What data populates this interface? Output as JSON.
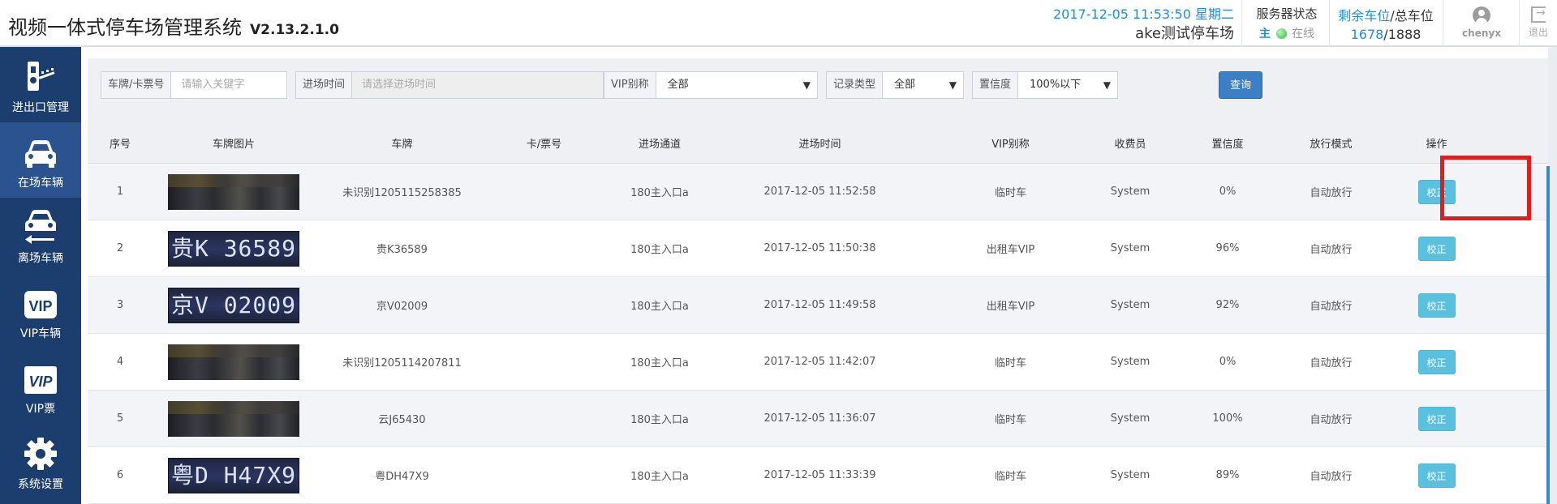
{
  "header": {
    "title": "视频一体式停车场管理系统",
    "version": "V2.13.2.1.0",
    "datetime": "2017-12-05 11:53:50 星期二",
    "lot_name": "ake测试停车场",
    "server_label": "服务器状态",
    "server_role": "主",
    "server_status": "在线",
    "spaces_label_remaining": "剩余车位",
    "spaces_label_sep": "/",
    "spaces_label_total": "总车位",
    "spaces_remaining": "1678",
    "spaces_total": "1888",
    "user": "chenyx",
    "logout": "退出"
  },
  "sidebar": {
    "items": [
      {
        "label": "进出口管理",
        "icon": "gate-barrier-icon"
      },
      {
        "label": "在场车辆",
        "icon": "car-icon"
      },
      {
        "label": "离场车辆",
        "icon": "car-leaving-icon"
      },
      {
        "label": "VIP车辆",
        "icon": "vip-icon"
      },
      {
        "label": "VIP票",
        "icon": "vip-ticket-icon"
      },
      {
        "label": "系统设置",
        "icon": "gear-icon"
      }
    ]
  },
  "filters": {
    "plate_label": "车牌/卡票号",
    "plate_placeholder": "请输入关键字",
    "time_label": "进场时间",
    "time_placeholder": "请选择进场时间",
    "vip_label": "VIP别称",
    "vip_value": "全部",
    "record_label": "记录类型",
    "record_value": "全部",
    "confidence_label": "置信度",
    "confidence_value": "100%以下",
    "query_button": "查询"
  },
  "table": {
    "columns": [
      "序号",
      "车牌图片",
      "车牌",
      "卡/票号",
      "进场通道",
      "进场时间",
      "VIP别称",
      "收费员",
      "置信度",
      "放行模式",
      "操作"
    ],
    "rows": [
      {
        "no": "1",
        "image": "scene",
        "plate_text": "",
        "plate": "未识别1205115258385",
        "card": "",
        "channel": "180主入口a",
        "time": "2017-12-05 11:52:58",
        "vip": "临时车",
        "operator": "System",
        "confidence": "0%",
        "mode": "自动放行",
        "action": "校正"
      },
      {
        "no": "2",
        "image": "plate",
        "plate_text": "贵K 36589",
        "plate": "贵K36589",
        "card": "",
        "channel": "180主入口a",
        "time": "2017-12-05 11:50:38",
        "vip": "出租车VIP",
        "operator": "System",
        "confidence": "96%",
        "mode": "自动放行",
        "action": "校正"
      },
      {
        "no": "3",
        "image": "plate",
        "plate_text": "京V 02009",
        "plate": "京V02009",
        "card": "",
        "channel": "180主入口a",
        "time": "2017-12-05 11:49:58",
        "vip": "出租车VIP",
        "operator": "System",
        "confidence": "92%",
        "mode": "自动放行",
        "action": "校正"
      },
      {
        "no": "4",
        "image": "scene",
        "plate_text": "",
        "plate": "未识别1205114207811",
        "card": "",
        "channel": "180主入口a",
        "time": "2017-12-05 11:42:07",
        "vip": "临时车",
        "operator": "System",
        "confidence": "0%",
        "mode": "自动放行",
        "action": "校正"
      },
      {
        "no": "5",
        "image": "scene",
        "plate_text": "",
        "plate": "云J65430",
        "card": "",
        "channel": "180主入口a",
        "time": "2017-12-05 11:36:07",
        "vip": "临时车",
        "operator": "System",
        "confidence": "100%",
        "mode": "自动放行",
        "action": "校正"
      },
      {
        "no": "6",
        "image": "plate",
        "plate_text": "粤D H47X9",
        "plate": "粤DH47X9",
        "card": "",
        "channel": "180主入口a",
        "time": "2017-12-05 11:33:39",
        "vip": "临时车",
        "operator": "System",
        "confidence": "89%",
        "mode": "自动放行",
        "action": "校正"
      }
    ]
  },
  "colors": {
    "sidebar_bg": "#1c3e6e",
    "sidebar_active": "#2a538f",
    "accent_blue": "#1c8ee6",
    "query_button": "#3d7fc4",
    "verify_button": "#5bc0de",
    "highlight": "#e21d1d"
  }
}
